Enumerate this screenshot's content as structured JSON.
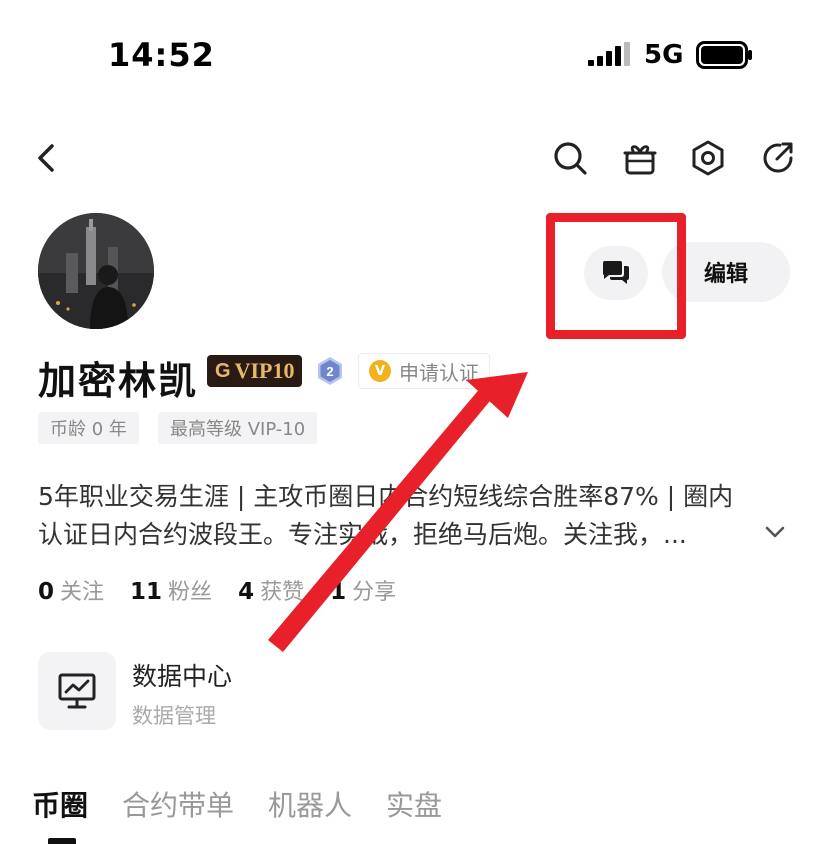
{
  "status_bar": {
    "time": "14:52",
    "network": "5G"
  },
  "nav": {
    "icons": [
      "back-icon",
      "search-icon",
      "gift-icon",
      "settings-icon",
      "share-icon"
    ]
  },
  "profile": {
    "name": "加密林凯",
    "vip_label": "VIP10",
    "level": "2",
    "verify_label": "申请认证",
    "verify_icon_text": "V",
    "tags": [
      "币龄 0 年",
      "最高等级 VIP-10"
    ],
    "bio_lines": [
      "5年职业交易生涯 | 主攻币圈日内合约短线综合胜率87% | 圈内",
      "认证日内合约波段王。专注实战，拒绝马后炮。关注我，..."
    ],
    "stats": [
      {
        "num": "0",
        "label": "关注"
      },
      {
        "num": "11",
        "label": "粉丝"
      },
      {
        "num": "4",
        "label": "获赞"
      },
      {
        "num": "1",
        "label": "分享"
      }
    ]
  },
  "actions": {
    "edit_label": "编辑"
  },
  "data_center": {
    "title": "数据中心",
    "subtitle": "数据管理"
  },
  "tabs": [
    "币圈",
    "合约带单",
    "机器人",
    "实盘"
  ],
  "colors": {
    "highlight": "#e8202a",
    "vip_bg": "#2a1a14",
    "vip_text": "#e6b96a",
    "verify_icon": "#f2b21c"
  }
}
